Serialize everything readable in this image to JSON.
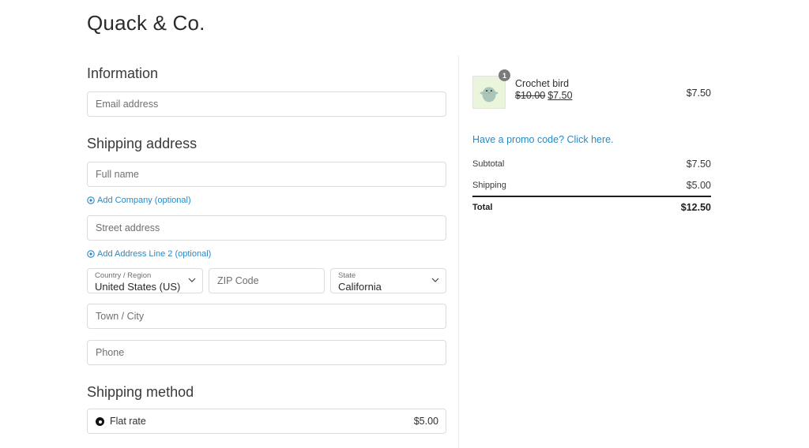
{
  "brand": "Quack & Co.",
  "information": {
    "title": "Information",
    "email_placeholder": "Email address"
  },
  "shipping_address": {
    "title": "Shipping address",
    "full_name_placeholder": "Full name",
    "add_company": "Add Company (optional)",
    "street_placeholder": "Street address",
    "add_address_line2": "Add Address Line 2 (optional)",
    "country": {
      "label": "Country / Region",
      "value": "United States (US)"
    },
    "zip_placeholder": "ZIP Code",
    "state": {
      "label": "State",
      "value": "California"
    },
    "city_placeholder": "Town / City",
    "phone_placeholder": "Phone"
  },
  "shipping_method": {
    "title": "Shipping method",
    "options": [
      {
        "name": "Flat rate",
        "price": "$5.00",
        "selected": true
      }
    ]
  },
  "order_summary": {
    "items": [
      {
        "name": "Crochet bird",
        "quantity": "1",
        "original_price": "$10.00",
        "sale_price": "$7.50",
        "line_total": "$7.50",
        "image": "crochet-bird-image"
      }
    ],
    "promo_link": "Have a promo code? Click here.",
    "subtotal_label": "Subtotal",
    "subtotal": "$7.50",
    "shipping_label": "Shipping",
    "shipping": "$5.00",
    "total_label": "Total",
    "total": "$12.50"
  },
  "colors": {
    "link": "#2a8ac4",
    "text": "#2f2f2f",
    "border": "#dcdcdc"
  }
}
